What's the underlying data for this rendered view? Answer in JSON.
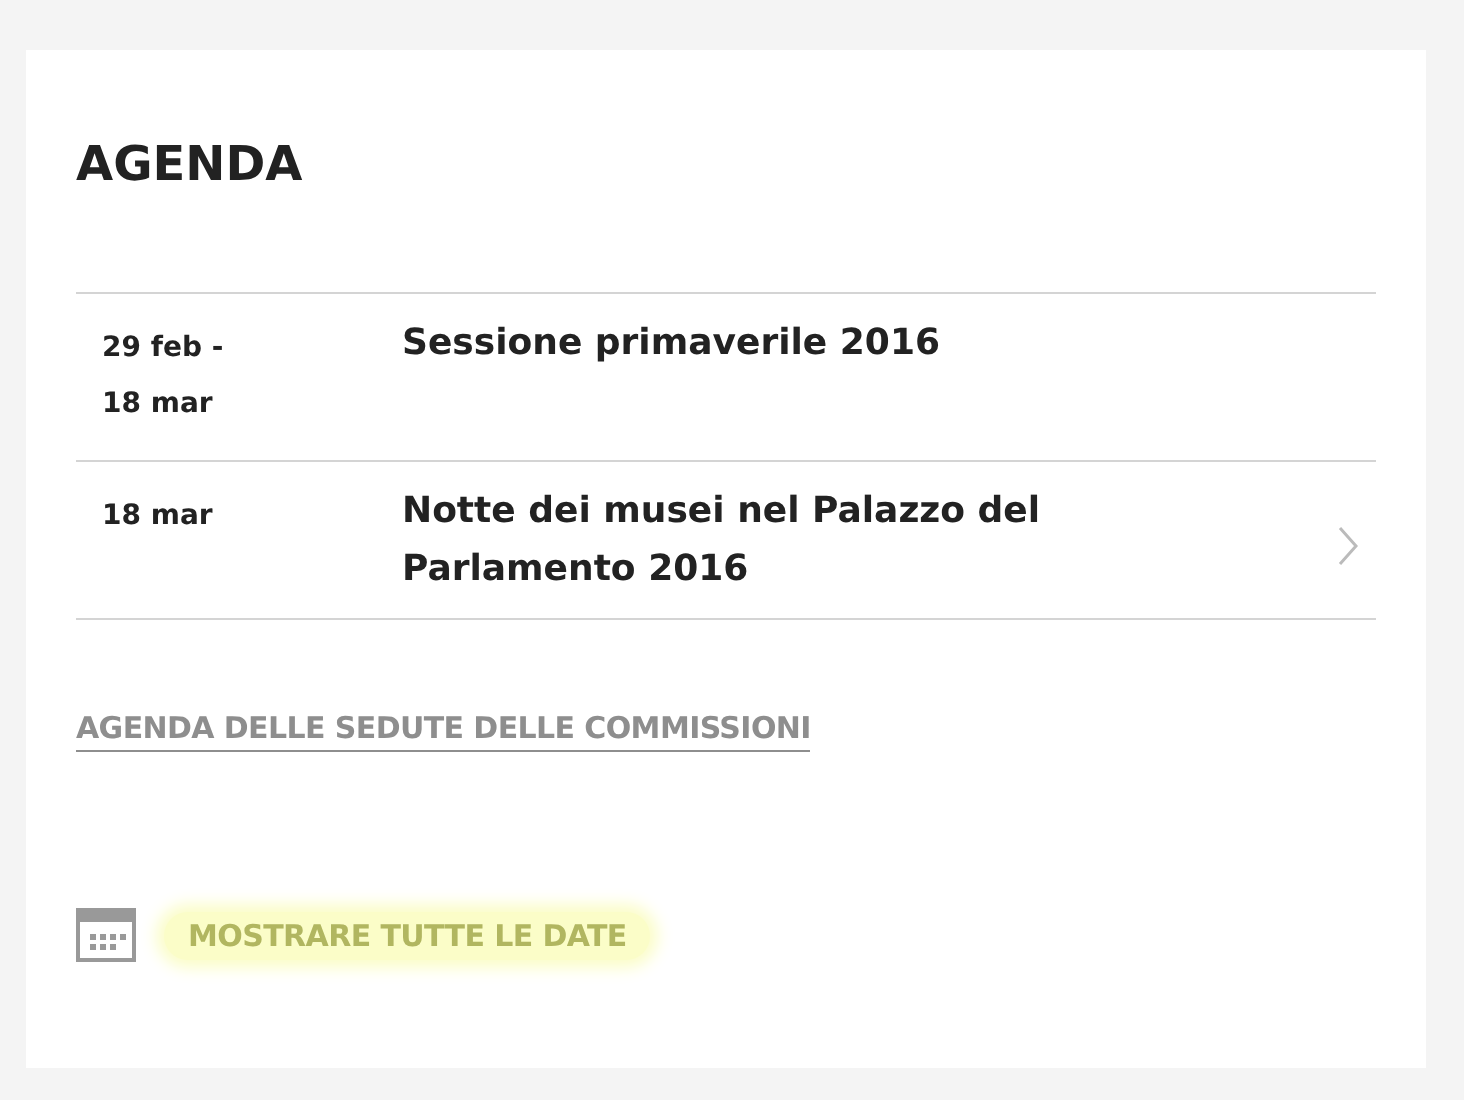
{
  "title": "AGENDA",
  "events": [
    {
      "date_lines": [
        "29 feb -",
        "18 mar"
      ],
      "title": "Sessione primaverile 2016",
      "arrow": false
    },
    {
      "date_lines": [
        "18 mar"
      ],
      "title": "Notte dei musei nel Palazzo del Parlamento 2016",
      "arrow": true
    }
  ],
  "committee_link": "AGENDA DELLE SEDUTE DELLE COMMISSIONI",
  "show_all": {
    "label": "MOSTRARE TUTTE LE DATE",
    "highlighted": true
  }
}
